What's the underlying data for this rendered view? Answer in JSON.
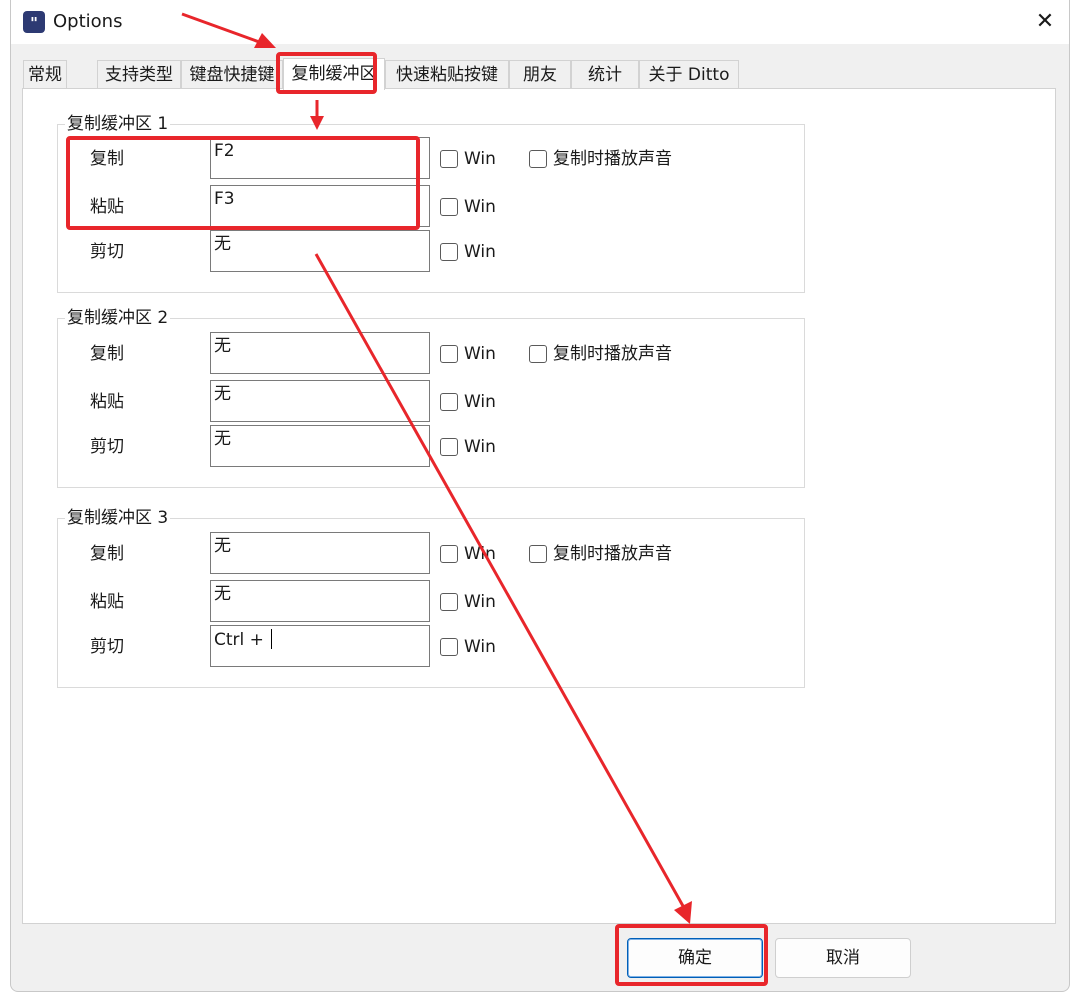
{
  "window": {
    "title": "Options",
    "icon": "ditto-app-icon",
    "close_glyph": "✕"
  },
  "tabs": [
    {
      "label": "常规",
      "active": false
    },
    {
      "label": "支持类型",
      "active": false
    },
    {
      "label": "键盘快捷键",
      "active": false
    },
    {
      "label": "复制缓冲区",
      "active": true
    },
    {
      "label": "快速粘贴按键",
      "active": false
    },
    {
      "label": "朋友",
      "active": false
    },
    {
      "label": "统计",
      "active": false
    },
    {
      "label": "关于 Ditto",
      "active": false
    }
  ],
  "buffers": [
    {
      "title": "复制缓冲区 1",
      "copy_label": "复制",
      "copy_value": "F2",
      "paste_label": "粘贴",
      "paste_value": "F3",
      "cut_label": "剪切",
      "cut_value": "无",
      "win_label": "Win",
      "sound_label": "复制时播放声音"
    },
    {
      "title": "复制缓冲区 2",
      "copy_label": "复制",
      "copy_value": "无",
      "paste_label": "粘贴",
      "paste_value": "无",
      "cut_label": "剪切",
      "cut_value": "无",
      "win_label": "Win",
      "sound_label": "复制时播放声音"
    },
    {
      "title": "复制缓冲区 3",
      "copy_label": "复制",
      "copy_value": "无",
      "paste_label": "粘贴",
      "paste_value": "无",
      "cut_label": "剪切",
      "cut_value": "Ctrl + ",
      "win_label": "Win",
      "sound_label": "复制时播放声音"
    }
  ],
  "buttons": {
    "ok": "确定",
    "cancel": "取消"
  },
  "colors": {
    "annotation_red": "#e8262b",
    "primary_border": "#005fb8",
    "app_icon_bg": "#2d3a73"
  }
}
